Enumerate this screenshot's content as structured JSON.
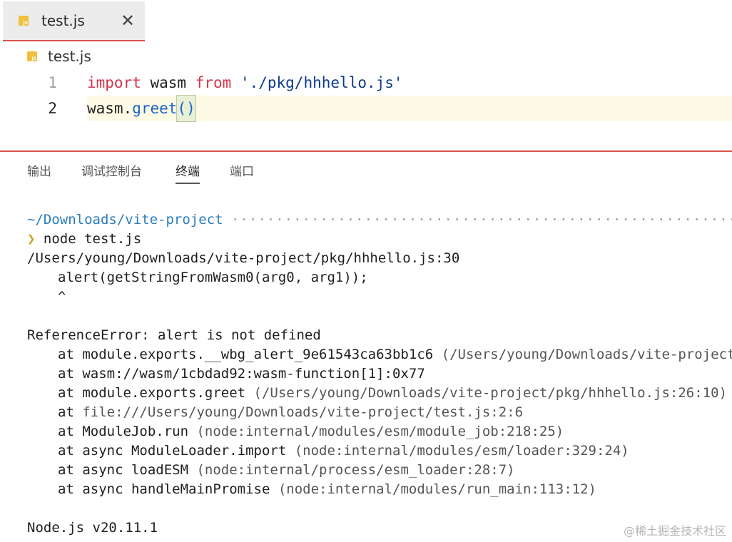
{
  "tab": {
    "icon": "js-file-icon",
    "label": "test.js",
    "close": "✕"
  },
  "breadcrumb": {
    "icon": "js-file-icon",
    "label": "test.js"
  },
  "editor": {
    "lines": [
      {
        "number": "1",
        "tokens": {
          "kw1": "import",
          "sp1": " wasm ",
          "kw2": "from",
          "sp2": " ",
          "str": "'./pkg/hhhello.js'"
        }
      },
      {
        "number": "2",
        "tokens": {
          "obj": "wasm",
          "dot": ".",
          "fn": "greet",
          "parens": "()"
        }
      }
    ]
  },
  "panel": {
    "tabs": [
      "输出",
      "调试控制台",
      "终端",
      "端口"
    ],
    "active_tab": "终端"
  },
  "terminal": {
    "prompt_path": "~/Downloads/vite-project",
    "prompt_dots": "··································································",
    "prompt_arrow": "❯",
    "command": "node test.js",
    "lines": [
      "/Users/young/Downloads/vite-project/pkg/hhhello.js:30",
      "alert(getStringFromWasm0(arg0, arg1));",
      "^",
      "ReferenceError: alert is not defined"
    ],
    "stack": [
      {
        "pre": "at module.exports.__wbg_alert_9e61543ca63bb1c6 ",
        "loc": "(/Users/young/Downloads/vite-project/pk"
      },
      {
        "pre": "at wasm://wasm/1cbdad92:wasm-function[1]:0x77",
        "loc": ""
      },
      {
        "pre": "at module.exports.greet ",
        "loc": "(/Users/young/Downloads/vite-project/pkg/hhhello.js:26:10)"
      },
      {
        "pre": "at ",
        "loc": "file:///Users/young/Downloads/vite-project/test.js:2:6"
      },
      {
        "pre": "at ModuleJob.run ",
        "loc": "(node:internal/modules/esm/module_job:218:25)"
      },
      {
        "pre": "at async ModuleLoader.import ",
        "loc": "(node:internal/modules/esm/loader:329:24)"
      },
      {
        "pre": "at async loadESM ",
        "loc": "(node:internal/process/esm_loader:28:7)"
      },
      {
        "pre": "at async handleMainPromise ",
        "loc": "(node:internal/modules/run_main:113:12)"
      }
    ],
    "version": "Node.js v20.11.1"
  },
  "watermark": "@稀土掘金技术社区",
  "colors": {
    "accent_red": "#d9534f",
    "keyword": "#d2374e",
    "string": "#0b3a8a",
    "function": "#1a63c8",
    "prompt_path": "#2b7cb8",
    "prompt_arrow": "#c9a227"
  }
}
